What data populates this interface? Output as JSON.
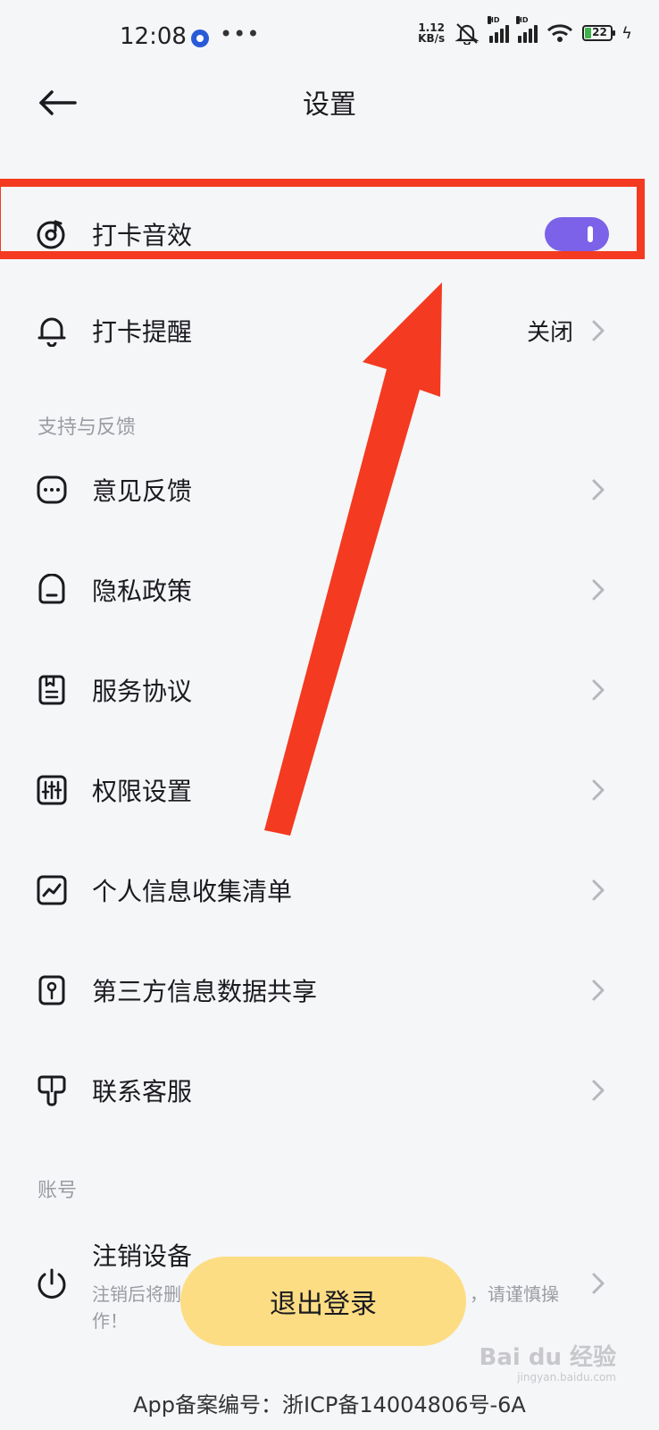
{
  "status_bar": {
    "time": "12:08",
    "more": "•••",
    "net_speed_value": "1.12",
    "net_speed_unit": "KB/s",
    "battery": "22",
    "hd": "HD"
  },
  "header": {
    "title": "设置"
  },
  "settings": {
    "sound": {
      "label": "打卡音效",
      "toggle_on": true
    },
    "reminder": {
      "label": "打卡提醒",
      "value": "关闭"
    }
  },
  "support": {
    "section_title": "支持与反馈",
    "items": [
      {
        "label": "意见反馈"
      },
      {
        "label": "隐私政策"
      },
      {
        "label": "服务协议"
      },
      {
        "label": "权限设置"
      },
      {
        "label": "个人信息收集清单"
      },
      {
        "label": "第三方信息数据共享"
      },
      {
        "label": "联系客服"
      }
    ]
  },
  "account": {
    "section_title": "账号",
    "deregister_label": "注销设备",
    "deregister_desc_left": "注销后将删",
    "deregister_desc_right": "，请谨慎操",
    "deregister_desc_line2": "作！"
  },
  "logout_label": "退出登录",
  "footer": "App备案编号：浙ICP备14004806号-6A",
  "watermark": {
    "brand": "Bai du 经验",
    "url": "jingyan.baidu.com"
  },
  "colors": {
    "toggle": "#7b62e8",
    "logout": "#fddd84",
    "annotation": "#f43a20"
  }
}
